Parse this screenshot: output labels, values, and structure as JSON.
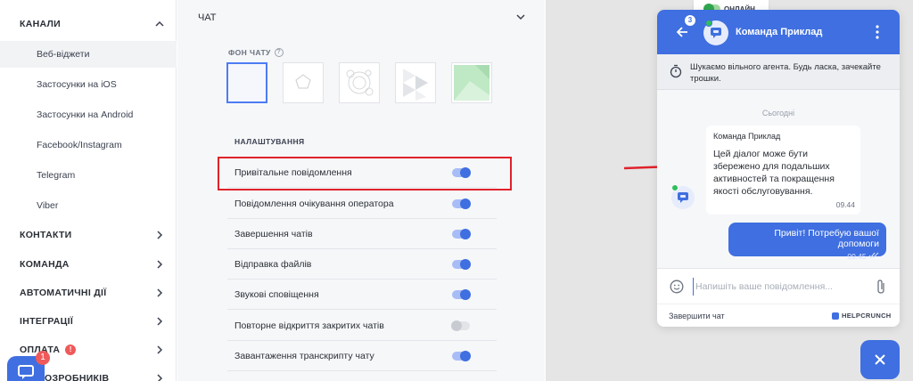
{
  "sidebar": {
    "channels": {
      "label": "КАНАЛИ",
      "items": [
        {
          "label": "Веб-віджети"
        },
        {
          "label": "Застосунки на iOS"
        },
        {
          "label": "Застосунки на Android"
        },
        {
          "label": "Facebook/Instagram"
        },
        {
          "label": "Telegram"
        },
        {
          "label": "Viber"
        }
      ]
    },
    "sections": [
      {
        "label": "КОНТАКТИ"
      },
      {
        "label": "КОМАНДА"
      },
      {
        "label": "АВТОМАТИЧНІ ДІЇ"
      },
      {
        "label": "ІНТЕГРАЦІЇ"
      },
      {
        "label": "ОПЛАТА",
        "badge": "!"
      },
      {
        "label": "ОЗРОБНИКІВ"
      }
    ],
    "launcher_count": "1"
  },
  "settings": {
    "chat_title": "ЧАТ",
    "background_label": "ФОН ЧАТУ",
    "help_glyph": "?",
    "settings_label": "НАЛАШТУВАННЯ",
    "rows": [
      {
        "label": "Привітальне повідомлення",
        "on": true
      },
      {
        "label": "Повідомлення очікування оператора",
        "on": true
      },
      {
        "label": "Завершення чатів",
        "on": true
      },
      {
        "label": "Відправка файлів",
        "on": true
      },
      {
        "label": "Звукові сповіщення",
        "on": true
      },
      {
        "label": "Повторне відкриття закритих чатів",
        "on": false
      },
      {
        "label": "Завантаження транскрипту чату",
        "on": true
      }
    ]
  },
  "widget": {
    "online_label": "ОНЛАЙН",
    "avatar_count": "3",
    "team_name": "Команда Приклад",
    "status_text": "Шукаємо вільного агента. Будь ласка, зачекайте трошки.",
    "today_label": "Сьогодні",
    "incoming": {
      "sender": "Команда Приклад",
      "text": "Цей діалог може бути збережено для подальших активностей та покращення якості обслуговування.",
      "time": "09.44"
    },
    "outgoing": {
      "text": "Привіт! Потребую вашої допомоги",
      "time": "09.45"
    },
    "input_placeholder": "Напишіть ваше повідомлення...",
    "end_chat_label": "Завершити чат",
    "brand": "HELPCRUNCH"
  },
  "colors": {
    "accent": "#3f6fe0",
    "highlight": "#e0222b",
    "online": "#2fa84f"
  }
}
